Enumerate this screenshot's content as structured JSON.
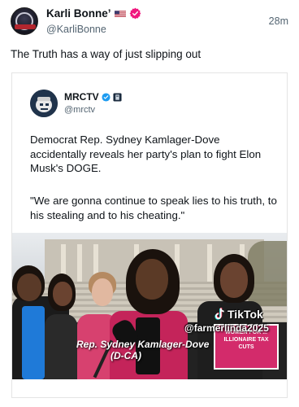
{
  "post": {
    "display_name": "Karli Bonne’",
    "handle": "@KarliBonne",
    "timestamp": "28m",
    "text": "The Truth has a way of just slipping out",
    "flag_icon": "us-flag-icon",
    "verified_icon": "verified-badge-icon",
    "verified_color": "#f0177e"
  },
  "quoted": {
    "name": "MRCTV",
    "handle": "@mrctv",
    "verified_color": "#1d9bf0",
    "body": "Democrat Rep. Sydney Kamlager-Dove accidentally reveals her party's plan to fight Elon Musk's DOGE.",
    "quote": "\"We are gonna continue to speak lies to his truth, to his stealing and to his cheating.\""
  },
  "video": {
    "tiktok_label": "TikTok",
    "tiktok_handle": "@farmerlinda2025",
    "caption_line1": "Rep. Sydney Kamlager-Dove",
    "caption_line2": "(D-CA)",
    "sign_text": "WOMEN FOR ... ILLIONAIRE TAX CUTS"
  },
  "colors": {
    "secondary_text": "#536471",
    "primary_text": "#0f1419",
    "jacket_pink": "#c4245a"
  }
}
